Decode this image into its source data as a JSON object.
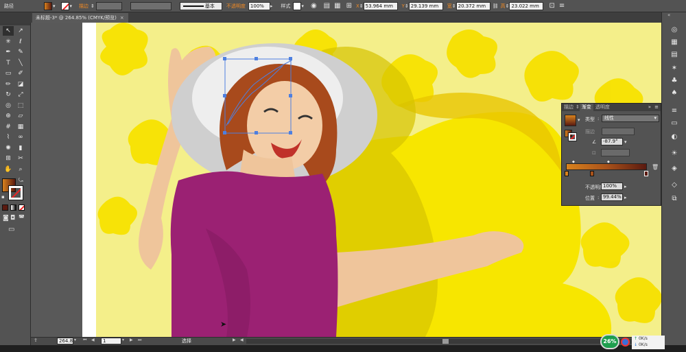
{
  "control_bar": {
    "object_type": "路径",
    "stroke_label": "描边",
    "stroke_profile": "基本",
    "opacity_label": "不透明度",
    "opacity_value": "100%",
    "style_label": "样式",
    "x_label": "X",
    "x_value": "53.964 mm",
    "y_label": "Y",
    "y_value": "29.139 mm",
    "w_label": "宽",
    "w_value": "20.372 mm",
    "h_label": "高",
    "h_value": "23.022 mm"
  },
  "document_tab": {
    "title": "未标题-3* @ 264.85% (CMYK/预览)",
    "close": "×"
  },
  "tools": [
    {
      "name": "selection-tool",
      "glyph": "↖"
    },
    {
      "name": "direct-selection-tool",
      "glyph": "↗"
    },
    {
      "name": "magic-wand-tool",
      "glyph": "✳"
    },
    {
      "name": "lasso-tool",
      "glyph": "ℓ"
    },
    {
      "name": "pen-tool",
      "glyph": "✒"
    },
    {
      "name": "curvature-tool",
      "glyph": "✎"
    },
    {
      "name": "type-tool",
      "glyph": "T"
    },
    {
      "name": "line-tool",
      "glyph": "╲"
    },
    {
      "name": "rectangle-tool",
      "glyph": "▭"
    },
    {
      "name": "paintbrush-tool",
      "glyph": "✐"
    },
    {
      "name": "pencil-tool",
      "glyph": "✏"
    },
    {
      "name": "eraser-tool",
      "glyph": "◪"
    },
    {
      "name": "rotate-tool",
      "glyph": "↻"
    },
    {
      "name": "scale-tool",
      "glyph": "⤢"
    },
    {
      "name": "warp-tool",
      "glyph": "◎"
    },
    {
      "name": "free-transform-tool",
      "glyph": "⬚"
    },
    {
      "name": "shape-builder-tool",
      "glyph": "⊕"
    },
    {
      "name": "perspective-tool",
      "glyph": "▱"
    },
    {
      "name": "mesh-tool",
      "glyph": "#"
    },
    {
      "name": "gradient-tool",
      "glyph": "▦"
    },
    {
      "name": "eyedropper-tool",
      "glyph": "⌇"
    },
    {
      "name": "blend-tool",
      "glyph": "∞"
    },
    {
      "name": "symbol-sprayer-tool",
      "glyph": "✺"
    },
    {
      "name": "column-graph-tool",
      "glyph": "▮"
    },
    {
      "name": "artboard-tool",
      "glyph": "⊞"
    },
    {
      "name": "slice-tool",
      "glyph": "✂"
    },
    {
      "name": "hand-tool",
      "glyph": "✋"
    },
    {
      "name": "zoom-tool",
      "glyph": "⌕"
    }
  ],
  "colors": {
    "fill_gradient_start": "#d8821e",
    "fill_gradient_end": "#5a1a10",
    "artwork_yellow": "#f7e600",
    "artwork_light_yellow": "#f4ef8a",
    "dress_purple": "#9b2173",
    "skin": "#efc59b",
    "hat_white": "#eeeeee"
  },
  "gradient_panel": {
    "tabs": [
      "描边",
      "渐变",
      "透明度"
    ],
    "active_tab": "渐变",
    "type_label": "类型",
    "type_value": "线性",
    "stroke_label": "描边",
    "angle_value": "-87.9°",
    "opacity_label": "不透明度",
    "opacity_value": "100%",
    "location_label": "位置",
    "location_value": "99.44%"
  },
  "status_bar": {
    "zoom": "264.85",
    "page": "1",
    "tool_name": "选择"
  },
  "network_widget": {
    "percent": "26%",
    "upload": "0K/s",
    "download": "0K/s"
  }
}
